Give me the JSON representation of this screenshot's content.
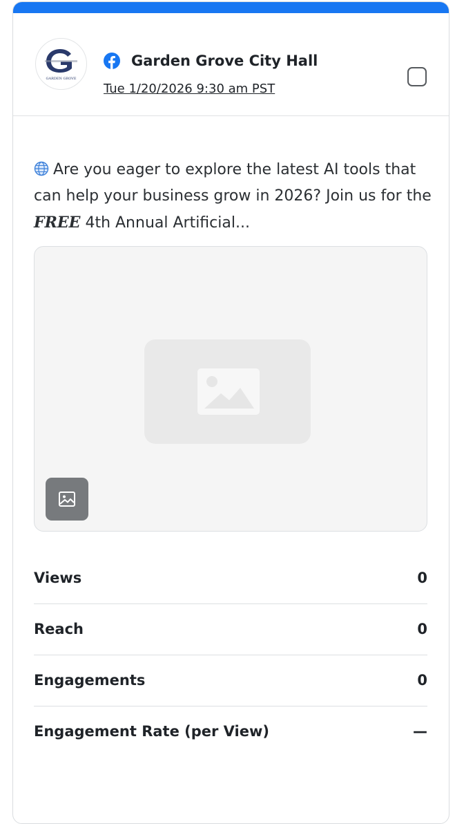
{
  "post": {
    "network": "Facebook",
    "network_icon": "facebook-icon",
    "account_name": "Garden Grove City Hall",
    "avatar_text": "GARDEN GROVE",
    "date": "Tue 1/20/2026 9:30 am PST",
    "text_before": "Are you eager to explore the latest AI tools that can help your business grow in 2026? Join us for the ",
    "text_emphasis": "FREE",
    "text_after": " 4th Annual Artificial...",
    "text_icon": "globe-icon",
    "media_type_icon": "image-icon"
  },
  "metrics": [
    {
      "label": "Views",
      "value": "0"
    },
    {
      "label": "Reach",
      "value": "0"
    },
    {
      "label": "Engagements",
      "value": "0"
    },
    {
      "label": "Engagement Rate (per View)",
      "value": "—"
    }
  ],
  "colors": {
    "accent": "#1877f2",
    "text": "#1f2328",
    "border": "#dcdfe2",
    "media_bg": "#f5f5f5"
  }
}
